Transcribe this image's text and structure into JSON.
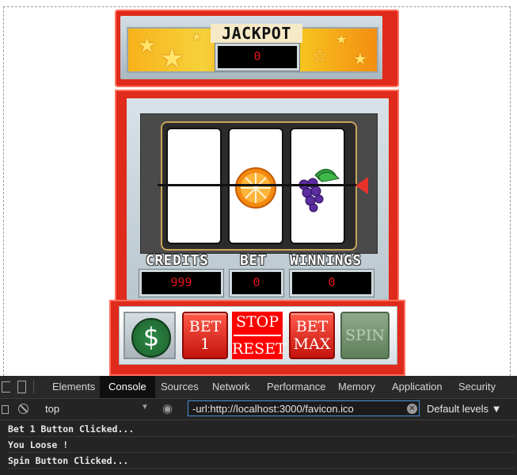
{
  "game": {
    "jackpot_title": "JACKPOT",
    "jackpot_value": "0",
    "reels": [
      "",
      "orange-slice",
      "grapes"
    ],
    "credits_label": "CREDITS",
    "bet_label": "BET",
    "winnings_label": "WINNINGS",
    "credits_value": "999",
    "bet_value": "0",
    "winnings_value": "0",
    "buttons": {
      "cashout_symbol": "$",
      "bet1_line1": "BET",
      "bet1_line2": "1",
      "stop_label": "STOP",
      "reset_label": "RESET",
      "betmax_line1": "BET",
      "betmax_line2": "MAX",
      "spin_label": "SPIN"
    },
    "colors": {
      "cabinet_red": "#e02a1b",
      "led_text": "#e3131b",
      "spin_disabled": "#6e8f69"
    }
  },
  "devtools": {
    "tabs": [
      "Elements",
      "Console",
      "Sources",
      "Network",
      "Performance",
      "Memory",
      "Application",
      "Security"
    ],
    "active_tab": "Console",
    "context": "top",
    "filter_value": "-url:http://localhost:3000/favicon.ico",
    "levels": "Default levels ▼",
    "logs": [
      "Bet 1 Button Clicked...",
      "You Loose !",
      "Spin Button Clicked..."
    ]
  }
}
